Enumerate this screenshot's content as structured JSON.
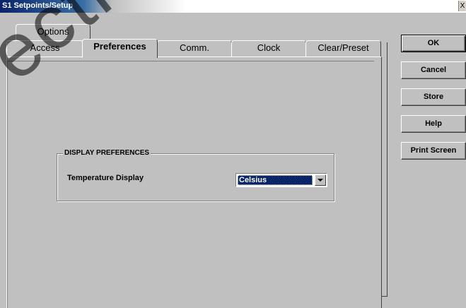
{
  "window": {
    "title": "S1 Setpoints/Setup",
    "close_glyph": "X"
  },
  "tabs": {
    "row1": [
      {
        "label": "Options"
      }
    ],
    "row2": [
      {
        "label": "Access"
      },
      {
        "label": "Preferences",
        "active": true
      },
      {
        "label": "Comm."
      },
      {
        "label": "Clock"
      },
      {
        "label": "Clear/Preset"
      }
    ]
  },
  "display_preferences": {
    "legend": "DISPLAY PREFERENCES",
    "temperature_label": "Temperature Display",
    "temperature_value": "Celsius"
  },
  "buttons": {
    "ok": "OK",
    "cancel": "Cancel",
    "store": "Store",
    "help": "Help",
    "print_screen": "Print Screen"
  },
  "watermark": {
    "text": "ectric"
  },
  "colors": {
    "face": "#c0c0c0",
    "title_active": "#0a246a",
    "selection": "#0a246a"
  }
}
